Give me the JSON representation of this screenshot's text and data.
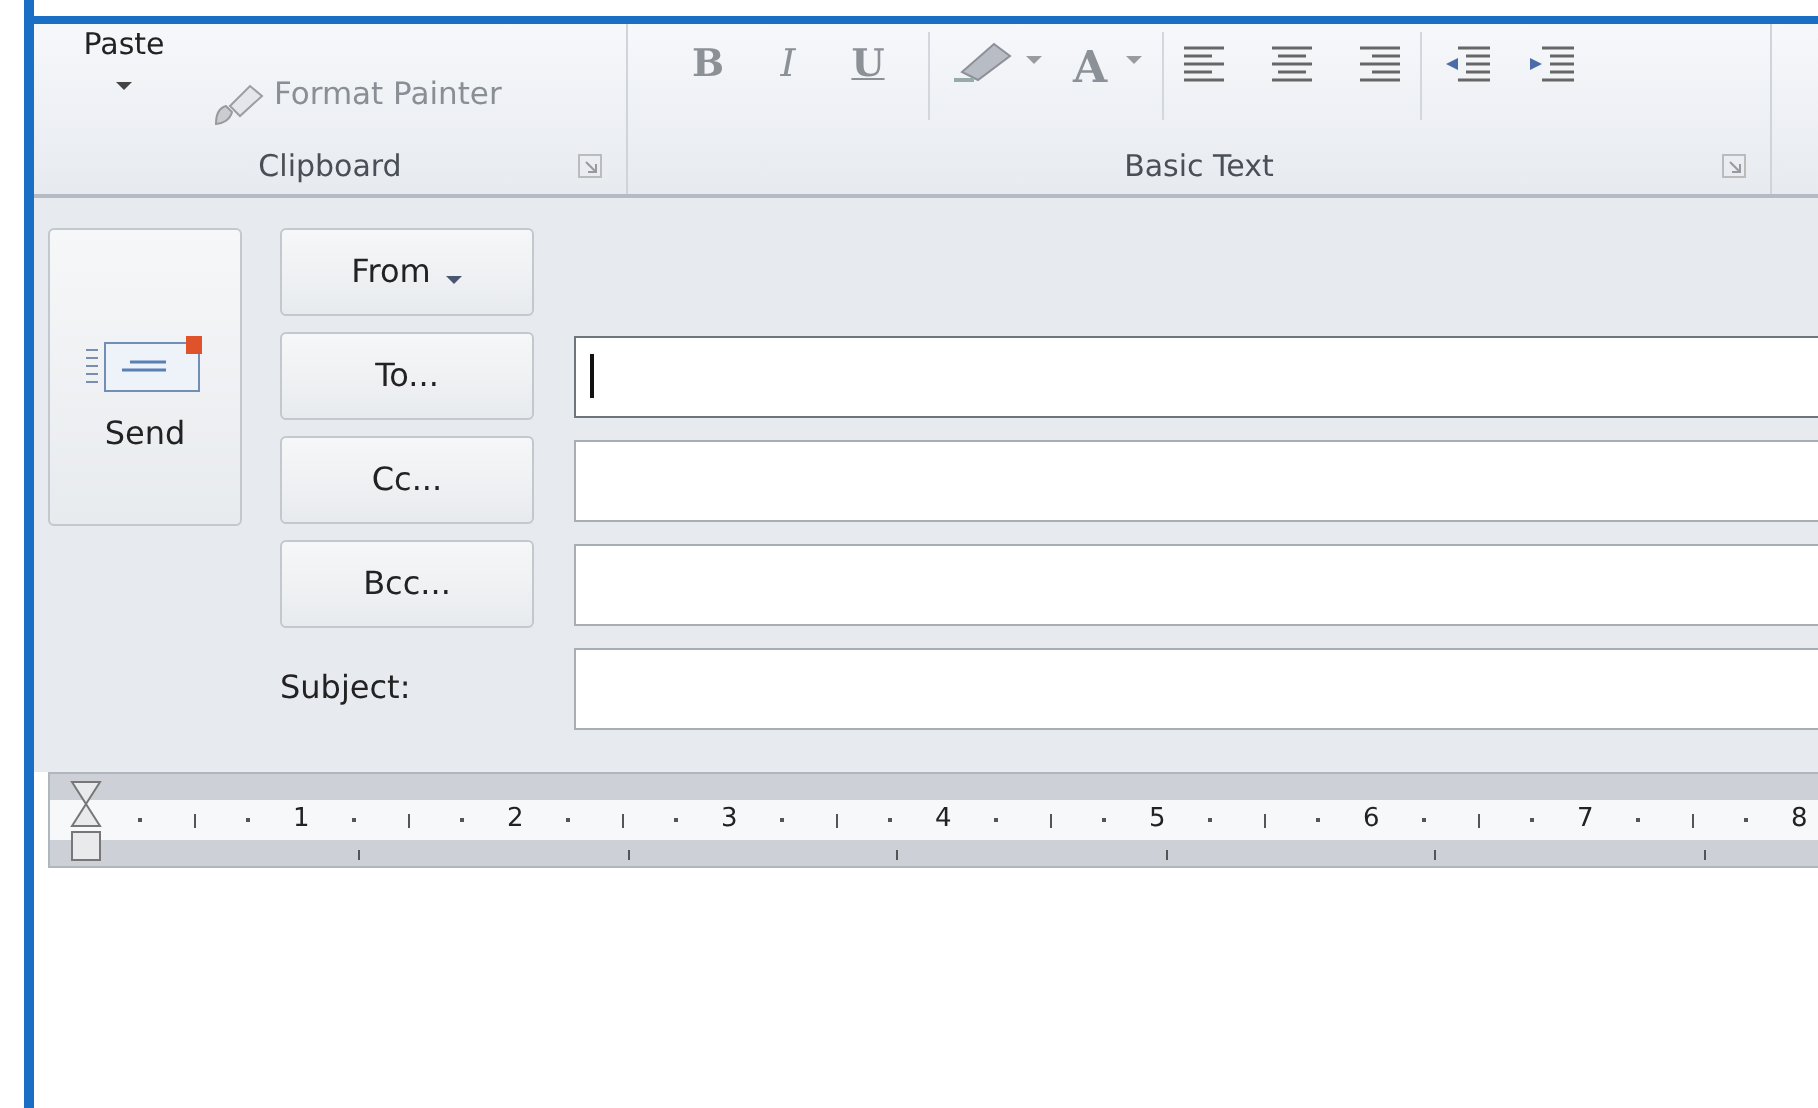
{
  "ribbon": {
    "paste": {
      "label": "Paste"
    },
    "format_painter": {
      "label": "Format Painter",
      "disabled": true
    },
    "format_buttons": [
      {
        "label": "B",
        "kind": "bold",
        "disabled": true
      },
      {
        "label": "I",
        "kind": "italic",
        "disabled": true
      },
      {
        "label": "U",
        "kind": "underline",
        "disabled": true
      }
    ],
    "font_color": {
      "label": "A",
      "disabled": true
    },
    "groups": [
      {
        "label": "Clipboard"
      },
      {
        "label": "Basic Text"
      }
    ]
  },
  "message": {
    "send": {
      "label": "Send"
    },
    "address_rows": [
      {
        "label": "From",
        "kind": "dropdown"
      },
      {
        "label": "To...",
        "kind": "field",
        "focused": true
      },
      {
        "label": "Cc...",
        "kind": "field",
        "focused": false
      },
      {
        "label": "Bcc...",
        "kind": "field",
        "focused": false
      }
    ],
    "subject": {
      "label": "Subject:"
    }
  },
  "ruler": {
    "marks": [
      "1",
      "2",
      "3",
      "4",
      "5",
      "6",
      "7",
      "8"
    ]
  }
}
